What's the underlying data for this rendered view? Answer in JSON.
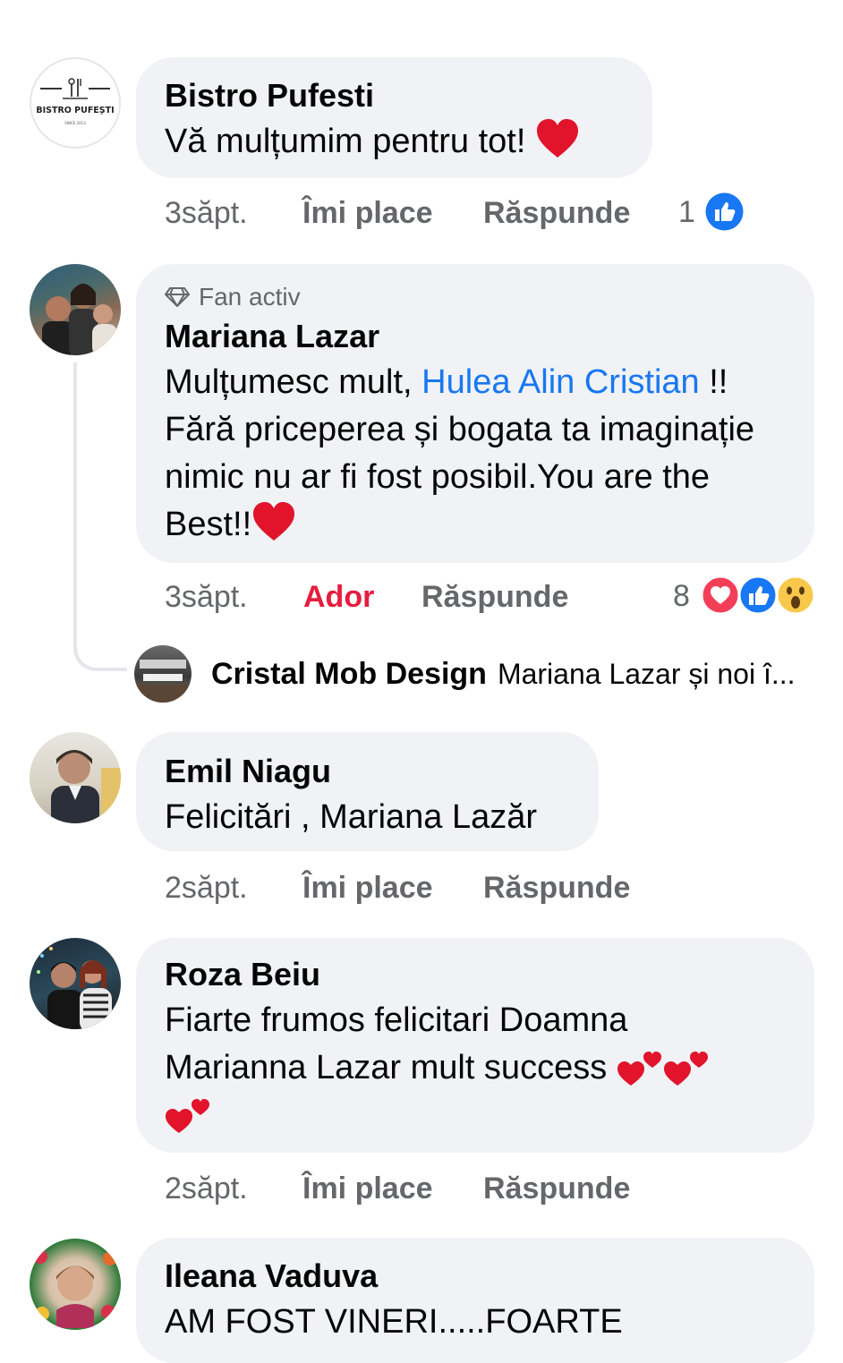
{
  "comments": [
    {
      "author": "Bistro Pufesti",
      "text": "Vă mulțumim pentru tot!",
      "time": "3săpt.",
      "like_label": "Îmi place",
      "reply_label": "Răspunde",
      "reaction_count": "1",
      "avatar": {
        "title": "BISTRO PUFEȘTI",
        "subtitle": "SINCE 2013"
      }
    },
    {
      "badge": "Fan activ",
      "author": "Mariana Lazar",
      "text_before": "Mulțumesc mult, ",
      "mention": "Hulea Alin Cristian",
      "text_after": " !! Fără priceperea și bogata ta imaginație nimic nu ar fi fost posibil.You are the Best!!",
      "time": "3săpt.",
      "like_label": "Ador",
      "reply_label": "Răspunde",
      "reaction_count": "8",
      "reply_preview": {
        "author": "Cristal Mob Design",
        "text": "Mariana Lazar și noi î..."
      }
    },
    {
      "author": "Emil Niagu",
      "text": "Felicitări , Mariana Lazăr",
      "time": "2săpt.",
      "like_label": "Îmi place",
      "reply_label": "Răspunde"
    },
    {
      "author": "Roza Beiu",
      "text_line1": "Fiarte frumos felicitari Doamna",
      "text_line2": "Marianna Lazar mult success",
      "time": "2săpt.",
      "like_label": "Îmi place",
      "reply_label": "Răspunde"
    },
    {
      "author": "Ileana Vaduva",
      "text": "AM FOST VINERI.....FOARTE"
    }
  ],
  "icons": {
    "like": "like-thumb-icon",
    "love": "love-heart-icon",
    "wow": "wow-face-icon",
    "diamond": "diamond-badge-icon",
    "heart_emoji": "red-heart-emoji",
    "two_hearts": "two-hearts-emoji"
  },
  "colors": {
    "bubble": "#f0f2f5",
    "link": "#1877f2",
    "love_red": "#e41e3f",
    "meta_gray": "#65676b"
  }
}
